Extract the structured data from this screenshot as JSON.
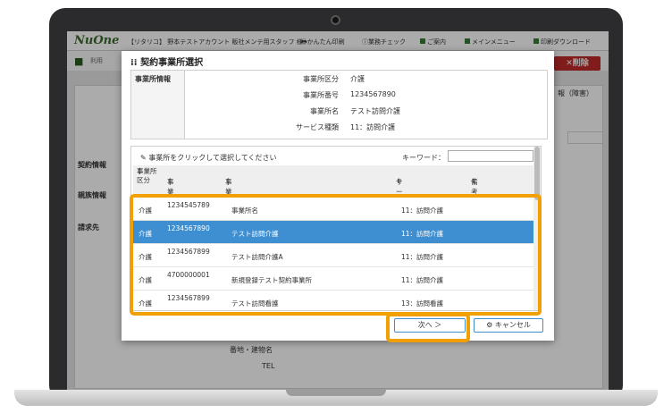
{
  "topbar": {
    "logo": "NuOne",
    "info": "【リタリコ】 野本テストアカウント 販社メンテ用スタッフ 様",
    "easy_print": "かんたん印刷",
    "tutorial": "業務チェック",
    "guide": "ご案内",
    "main_menu": "メインメニュー",
    "print_download": "印刷ダウンロード"
  },
  "nav": {
    "home_icon": "home-icon",
    "breadcrumb": "利用",
    "delete_label": "✕削除"
  },
  "background": {
    "tab_label": "報（障害）",
    "contract_info": "契約情報",
    "guardian_info": "親族情報",
    "billing": "請求先",
    "address_label": "番地・建物名",
    "tel_label": "TEL"
  },
  "dialog": {
    "title": "契約事業所選択",
    "info_header": "事業所情報",
    "info": [
      {
        "key": "事業所区分",
        "value": "介護"
      },
      {
        "key": "事業所番号",
        "value": "1234567890"
      },
      {
        "key": "事業所名",
        "value": "テスト訪問介護"
      },
      {
        "key": "サービス種類",
        "value": "11：訪問介護"
      }
    ],
    "instruction": "事業所をクリックして選択してください",
    "keyword_label": "キーワード：",
    "keyword_value": "",
    "columns": {
      "category": "事業所区分",
      "number": "事業所番号",
      "name": "事業所名",
      "service": "サービス種類",
      "note": "備考"
    },
    "rows": [
      {
        "category": "介護",
        "number": "1234545789",
        "name": "事業所名",
        "service": "11：訪問介護"
      },
      {
        "category": "介護",
        "number": "1234567890",
        "name": "テスト訪問介護",
        "service": "11：訪問介護"
      },
      {
        "category": "介護",
        "number": "1234567899",
        "name": "テスト訪問介護A",
        "service": "11：訪問介護"
      },
      {
        "category": "介護",
        "number": "4700000001",
        "name": "新規登録テスト契約事業所",
        "service": "11：訪問介護"
      },
      {
        "category": "介護",
        "number": "1234567899",
        "name": "テスト訪問看護",
        "service": "13：訪問看護"
      }
    ],
    "next_label": "次へ ＞",
    "cancel_label": "キャンセル"
  },
  "colors": {
    "highlight": "#f0a000",
    "selected_row": "#3d8fd1",
    "delete_button": "#c02a2a",
    "brand_green": "#3a7c36"
  }
}
